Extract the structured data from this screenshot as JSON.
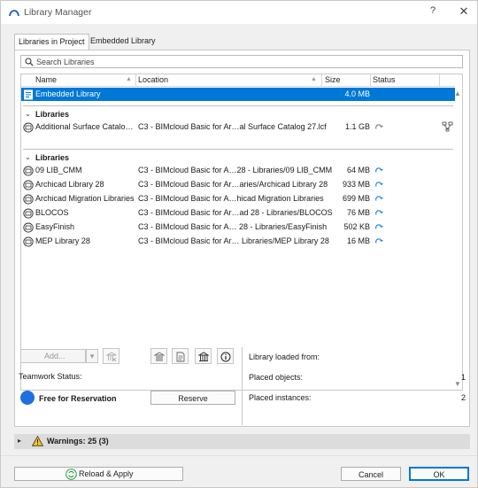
{
  "window": {
    "title": "Library Manager",
    "help_label": "?",
    "close_label": "✕"
  },
  "tabs": [
    {
      "label": "Libraries in Project",
      "active": true
    },
    {
      "label": "Embedded Library",
      "active": false
    }
  ],
  "search": {
    "placeholder": "Search Libraries",
    "value": ""
  },
  "columns": {
    "name": "Name",
    "location": "Location",
    "size": "Size",
    "status": "Status"
  },
  "embedded_row": {
    "name": "Embedded Library",
    "location": "",
    "size": "4.0 MB",
    "selected": true
  },
  "groups": [
    {
      "label": "Libraries",
      "items": [
        {
          "name": "Additional Surface Catalo…",
          "location": "C3 - BIMcloud Basic for Ar…al Surface Catalog 27.lcf",
          "size": "1.1 GB",
          "status_icon": "cloud-sync-gray-icon",
          "extra_icon": "mapping-icon"
        }
      ]
    },
    {
      "label": "Libraries",
      "items": [
        {
          "name": "09 LIB_CMM",
          "location": "C3 - BIMcloud Basic for A…28 - Libraries/09 LIB_CMM",
          "size": "64 MB",
          "status_icon": "cloud-sync-icon"
        },
        {
          "name": "Archicad Library 28",
          "location": "C3 - BIMcloud Basic for Ar…aries/Archicad Library 28",
          "size": "933 MB",
          "status_icon": "cloud-sync-icon"
        },
        {
          "name": "Archicad Migration Libraries",
          "location": "C3 - BIMcloud Basic for A…hicad Migration Libraries",
          "size": "699 MB",
          "status_icon": "cloud-sync-icon"
        },
        {
          "name": "BLOCOS",
          "location": "C3 - BIMcloud Basic for Ar…ad 28 - Libraries/BLOCOS",
          "size": "76 MB",
          "status_icon": "cloud-sync-icon"
        },
        {
          "name": "EasyFinish",
          "location": "C3 - BIMcloud Basic for A… 28 - Libraries/EasyFinish",
          "size": "502 KB",
          "status_icon": "cloud-sync-icon"
        },
        {
          "name": "MEP Library 28",
          "location": "C3 - BIMcloud Basic for Ar… Libraries/MEP Library 28",
          "size": "16 MB",
          "status_icon": "cloud-sync-icon"
        }
      ]
    }
  ],
  "toolbar": {
    "add_label": "Add..."
  },
  "teamwork": {
    "label": "Teamwork Status:",
    "status": "Free for Reservation",
    "status_color": "#1e6fe0",
    "reserve_label": "Reserve"
  },
  "info": {
    "loaded_from_label": "Library loaded from:",
    "placed_objects_label": "Placed objects:",
    "placed_objects_value": "1",
    "placed_instances_label": "Placed instances:",
    "placed_instances_value": "2"
  },
  "warnings": {
    "label": "Warnings: 25 (3)"
  },
  "footer": {
    "reload_label": "Reload & Apply",
    "cancel_label": "Cancel",
    "ok_label": "OK"
  },
  "colors": {
    "accent": "#0078d7",
    "selection": "#0078d7",
    "cloud_icon": "#1e88e5"
  }
}
